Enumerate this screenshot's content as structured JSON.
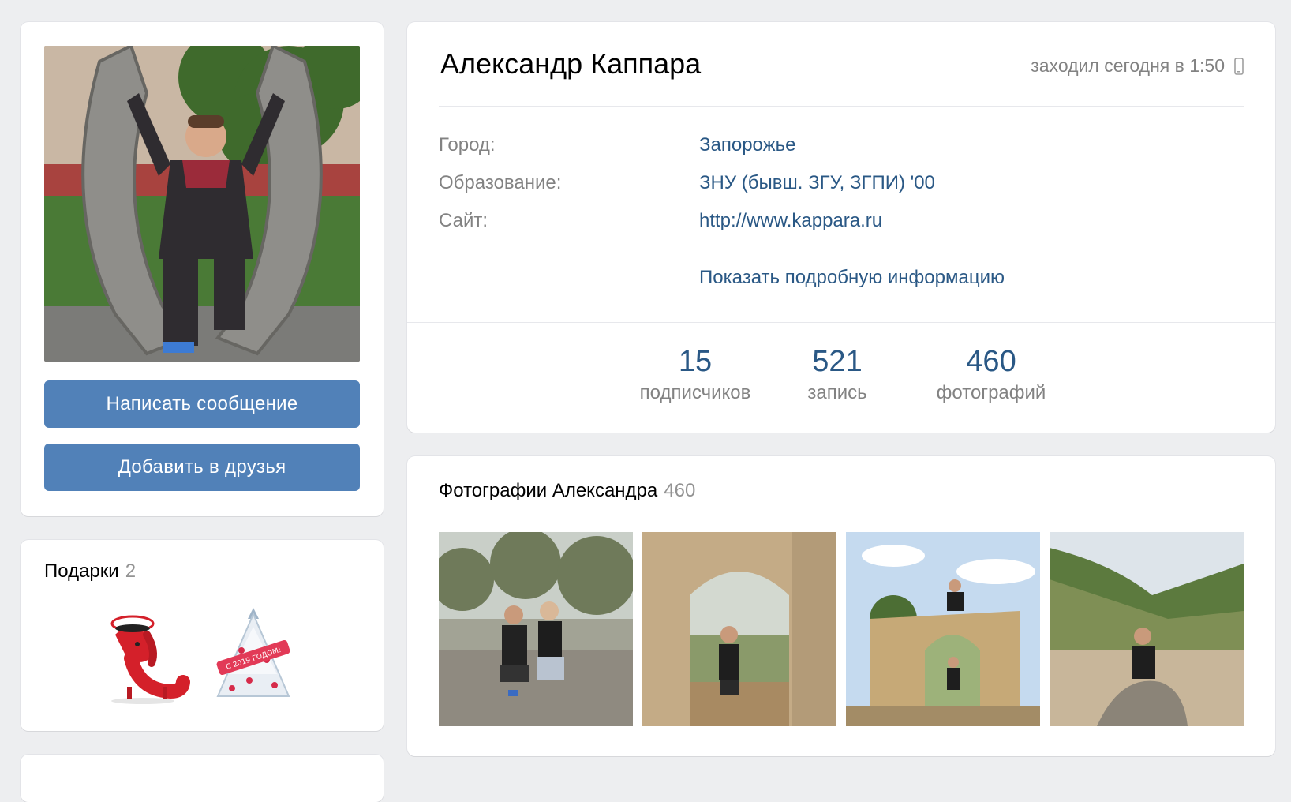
{
  "profile": {
    "name": "Александр Каппара",
    "last_seen": "заходил сегодня в 1:50",
    "info": {
      "city_label": "Город:",
      "city_value": "Запорожье",
      "education_label": "Образование:",
      "education_value": "ЗНУ (бывш. ЗГУ, ЗГПИ) '00",
      "site_label": "Сайт:",
      "site_value": "http://www.kappara.ru",
      "more_link": "Показать подробную информацию"
    },
    "counters": [
      {
        "value": "15",
        "label": "подписчиков"
      },
      {
        "value": "521",
        "label": "запись"
      },
      {
        "value": "460",
        "label": "фотографий"
      }
    ]
  },
  "actions": {
    "message_button": "Написать сообщение",
    "add_friend_button": "Добавить в друзья"
  },
  "gifts": {
    "title": "Подарки",
    "count": "2",
    "gift_text": "С 2019 ГОДОМ!"
  },
  "photos": {
    "title": "Фотографии Александра",
    "count": "460"
  },
  "colors": {
    "accent": "#5181b8",
    "link": "#2a5885",
    "muted": "#828282",
    "background": "#edeef0"
  }
}
